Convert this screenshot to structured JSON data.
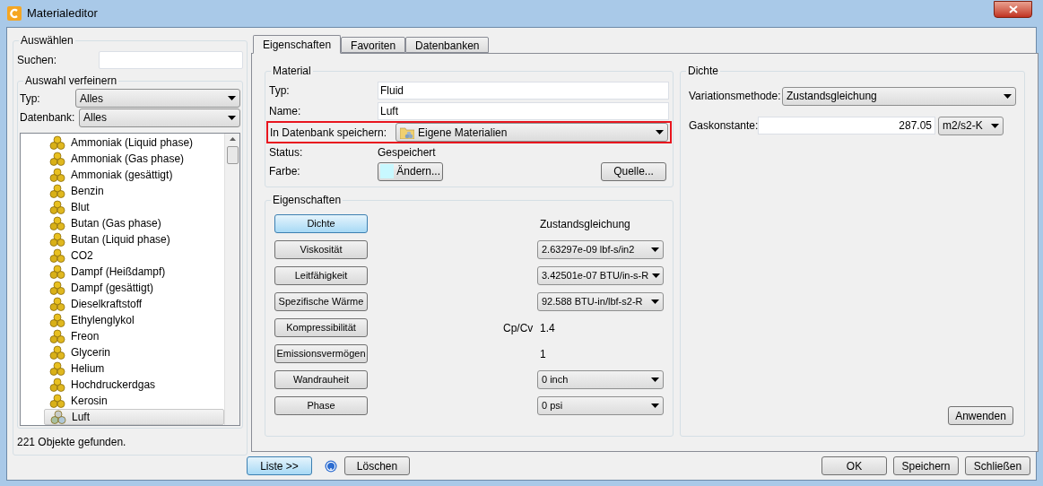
{
  "window": {
    "title": "Materialeditor"
  },
  "select_panel": {
    "title": "Auswählen",
    "search": {
      "label": "Suchen:"
    },
    "refine": {
      "title": "Auswahl verfeinern",
      "type": {
        "label": "Typ:",
        "value": "Alles"
      },
      "database": {
        "label": "Datenbank:",
        "value": "Alles"
      }
    },
    "materials": [
      {
        "name": "Ammoniak  (Liquid phase)",
        "selected": false
      },
      {
        "name": "Ammoniak (Gas phase)",
        "selected": false
      },
      {
        "name": "Ammoniak (gesättigt)",
        "selected": false
      },
      {
        "name": "Benzin",
        "selected": false
      },
      {
        "name": "Blut",
        "selected": false
      },
      {
        "name": "Butan (Gas phase)",
        "selected": false
      },
      {
        "name": "Butan (Liquid phase)",
        "selected": false
      },
      {
        "name": "CO2",
        "selected": false
      },
      {
        "name": "Dampf (Heißdampf)",
        "selected": false
      },
      {
        "name": "Dampf (gesättigt)",
        "selected": false
      },
      {
        "name": "Dieselkraftstoff",
        "selected": false
      },
      {
        "name": "Ethylenglykol",
        "selected": false
      },
      {
        "name": "Freon",
        "selected": false
      },
      {
        "name": "Glycerin",
        "selected": false
      },
      {
        "name": "Helium",
        "selected": false
      },
      {
        "name": "Hochdruckerdgas",
        "selected": false
      },
      {
        "name": "Kerosin",
        "selected": false
      },
      {
        "name": "Luft",
        "selected": true
      }
    ],
    "count": "221 Objekte gefunden."
  },
  "tabs": [
    {
      "label": "Eigenschaften",
      "selected": true
    },
    {
      "label": "Favoriten",
      "selected": false
    },
    {
      "label": "Datenbanken",
      "selected": false
    }
  ],
  "material": {
    "title": "Material",
    "type": {
      "label": "Typ:",
      "value": "Fluid"
    },
    "name": {
      "label": "Name:",
      "value": "Luft"
    },
    "database": {
      "label": "In Datenbank speichern:",
      "value": "Eigene Materialien",
      "highlighted": true
    },
    "status": {
      "label": "Status:",
      "value": "Gespeichert"
    },
    "color": {
      "label": "Farbe:",
      "button": "Ändern...",
      "color": "#c8f8ff"
    },
    "source_button": "Quelle..."
  },
  "properties": {
    "title": "Eigenschaften",
    "items": [
      {
        "label": "Dichte",
        "selected": true,
        "kind": "text",
        "value": "Zustandsgleichung"
      },
      {
        "label": "Viskosität",
        "selected": false,
        "kind": "dropdown",
        "value": "2.63297e-09 lbf-s/in2"
      },
      {
        "label": "Leitfähigkeit",
        "selected": false,
        "kind": "dropdown",
        "value": "3.42501e-07 BTU/in-s-R"
      },
      {
        "label": "Spezifische Wärme",
        "selected": false,
        "kind": "dropdown",
        "value": "92.588 BTU-in/lbf-s2-R"
      },
      {
        "label": "Kompressibilität",
        "selected": false,
        "kind": "ratio",
        "prefix": "Cp/Cv",
        "value": "1.4"
      },
      {
        "label": "Emissionsvermögen",
        "selected": false,
        "kind": "text",
        "value": "1"
      },
      {
        "label": "Wandrauheit",
        "selected": false,
        "kind": "dropdown",
        "value": "0 inch"
      },
      {
        "label": "Phase",
        "selected": false,
        "kind": "dropdown",
        "value": "0 psi"
      }
    ]
  },
  "density": {
    "title": "Dichte",
    "method": {
      "label": "Variationsmethode:",
      "value": "Zustandsgleichung"
    },
    "gas_constant": {
      "label": "Gaskonstante:",
      "value": "287.05",
      "unit": "m2/s2-K"
    },
    "apply_button": "Anwenden"
  },
  "footer": {
    "list_button": "Liste >>",
    "delete_button": "Löschen",
    "ok_button": "OK",
    "save_button": "Speichern",
    "close_button": "Schließen"
  }
}
